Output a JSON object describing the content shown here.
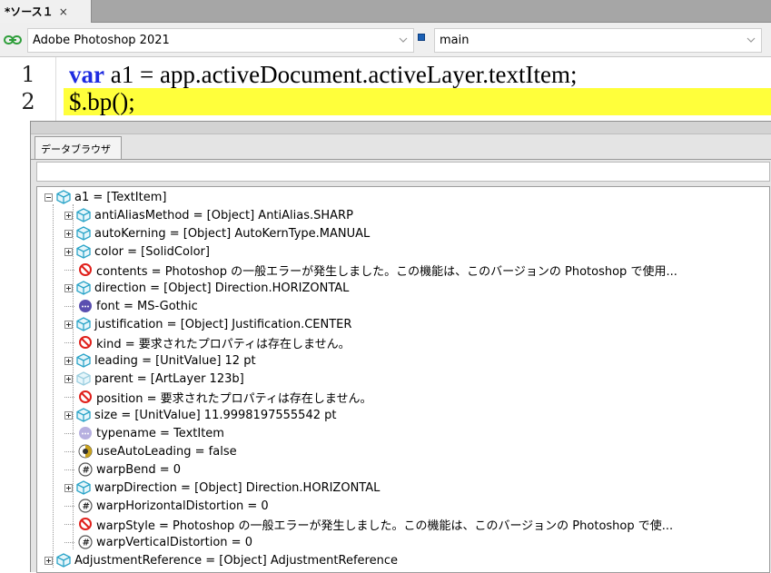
{
  "tab": {
    "label": "*ソース１",
    "close": "×"
  },
  "target": {
    "application": "Adobe Photoshop 2021",
    "engine": "main"
  },
  "editor": {
    "lines": [
      {
        "number": "1",
        "keyword": "var",
        "code": " a1 = app.activeDocument.activeLayer.textItem;",
        "highlighted": false
      },
      {
        "number": "2",
        "keyword": "",
        "code": "$.bp();",
        "highlighted": true
      }
    ],
    "highlight_color": "#ffff3b",
    "keyword_color": "#1e2be0"
  },
  "data_browser": {
    "tab_label": "データブラウザ",
    "filter_value": "",
    "root": {
      "label": "a1 = [TextItem]",
      "icon": "object-icon",
      "expanded": true
    },
    "children": [
      {
        "label": "antiAliasMethod = [Object] AntiAlias.SHARP",
        "icon": "object-icon",
        "expandable": true
      },
      {
        "label": "autoKerning = [Object] AutoKernType.MANUAL",
        "icon": "object-icon",
        "expandable": true
      },
      {
        "label": "color = [SolidColor]",
        "icon": "object-icon",
        "expandable": true
      },
      {
        "label": "contents = Photoshop の一般エラーが発生しました。この機能は、このバージョンの Photoshop で使用...",
        "icon": "error-icon",
        "expandable": false
      },
      {
        "label": "direction = [Object] Direction.HORIZONTAL",
        "icon": "object-icon",
        "expandable": true
      },
      {
        "label": "font = MS-Gothic",
        "icon": "string-icon",
        "expandable": false
      },
      {
        "label": "justification = [Object] Justification.CENTER",
        "icon": "object-icon",
        "expandable": true
      },
      {
        "label": "kind = 要求されたプロパティは存在しません。",
        "icon": "error-icon",
        "expandable": false
      },
      {
        "label": "leading = [UnitValue] 12 pt",
        "icon": "object-icon",
        "expandable": true
      },
      {
        "label": "parent = [ArtLayer 123b]",
        "icon": "object-faded-icon",
        "expandable": true
      },
      {
        "label": "position = 要求されたプロパティは存在しません。",
        "icon": "error-icon",
        "expandable": false
      },
      {
        "label": "size = [UnitValue] 11.9998197555542 pt",
        "icon": "object-icon",
        "expandable": true
      },
      {
        "label": "typename = TextItem",
        "icon": "string-faded-icon",
        "expandable": false
      },
      {
        "label": "useAutoLeading = false",
        "icon": "boolean-icon",
        "expandable": false
      },
      {
        "label": "warpBend = 0",
        "icon": "number-icon",
        "expandable": false
      },
      {
        "label": "warpDirection = [Object] Direction.HORIZONTAL",
        "icon": "object-icon",
        "expandable": true
      },
      {
        "label": "warpHorizontalDistortion = 0",
        "icon": "number-icon",
        "expandable": false
      },
      {
        "label": "warpStyle = Photoshop の一般エラーが発生しました。この機能は、このバージョンの Photoshop で使...",
        "icon": "error-icon",
        "expandable": false
      },
      {
        "label": "warpVerticalDistortion = 0",
        "icon": "number-icon",
        "expandable": false
      }
    ],
    "sibling": {
      "label": "AdjustmentReference = [Object] AdjustmentReference",
      "icon": "object-icon",
      "expandable": true
    }
  },
  "colors": {
    "object_icon": "#2aa4c8",
    "error_icon": "#e0201b",
    "string_icon": "#5a4fb0",
    "boolean_icon": "#c9a21e",
    "number_icon": "#555555"
  }
}
